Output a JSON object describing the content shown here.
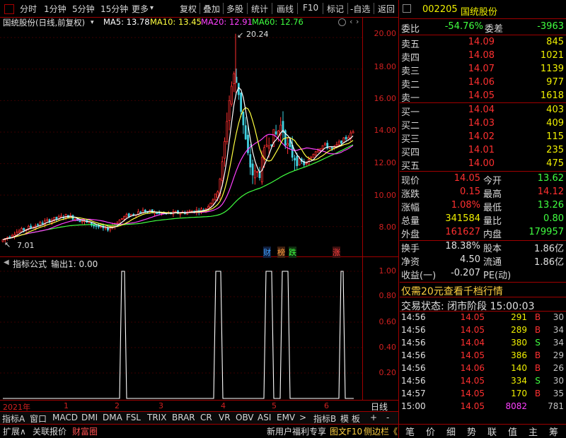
{
  "toolbar": {
    "items": [
      "分时",
      "1分钟",
      "5分钟",
      "15分钟",
      "更多",
      "复权",
      "叠加",
      "多股",
      "统计",
      "画线",
      "F10",
      "标记",
      "-自选",
      "返回"
    ],
    "more_arrow": "▾"
  },
  "chart": {
    "stock_title": "国统股份(日线,前复权)",
    "ma5": "MA5: 13.78",
    "ma10": "MA10: 13.45",
    "ma20": "MA20: 12.91",
    "ma60": "MA60: 12.76",
    "y_axis": [
      "20.00",
      "18.00",
      "16.00",
      "14.00",
      "12.00",
      "10.00",
      "8.00"
    ],
    "max_label": "20.24",
    "min_label": "7.01",
    "markers": [
      "财",
      "榜",
      "跌",
      "涨"
    ],
    "colors": {
      "up": "#ff3030",
      "down": "#40d0e0",
      "ma5": "#ffffff",
      "ma10": "#ffff40",
      "ma20": "#ff40ff",
      "ma60": "#40ff40",
      "axis": "#d02020"
    }
  },
  "indicator": {
    "title": "指标公式",
    "output": "输出1: 0.00",
    "y_axis": [
      "1.00",
      "0.80",
      "0.60",
      "0.40",
      "0.20"
    ]
  },
  "time_axis": {
    "year": "2021年",
    "months": [
      "1",
      "2",
      "3",
      "4",
      "5",
      "6"
    ],
    "period": "日线"
  },
  "tabs": [
    "指标A",
    "窗口",
    "MACD",
    "DMI",
    "DMA",
    "FSL",
    "TRIX",
    "BRAR",
    "CR",
    "VR",
    "OBV",
    "ASI",
    "EMV",
    "指标B",
    "模",
    "板"
  ],
  "tab_arrow": ">",
  "tab_controls": [
    "+",
    "-"
  ],
  "bottom_bar": {
    "left": [
      "扩展∧",
      "关联报价",
      "财富圈"
    ],
    "right": [
      "新用户福利专享",
      "图文F10",
      "侧边栏《"
    ]
  },
  "quote": {
    "code": "002205",
    "name": "国统股份",
    "weibi_label": "委比",
    "weibi": "-54.76%",
    "weicha_label": "委差",
    "weicha": "-3963",
    "sells": [
      {
        "label": "卖五",
        "price": "14.09",
        "vol": "845"
      },
      {
        "label": "卖四",
        "price": "14.08",
        "vol": "1021"
      },
      {
        "label": "卖三",
        "price": "14.07",
        "vol": "1139"
      },
      {
        "label": "卖二",
        "price": "14.06",
        "vol": "977"
      },
      {
        "label": "卖一",
        "price": "14.05",
        "vol": "1618"
      }
    ],
    "buys": [
      {
        "label": "买一",
        "price": "14.04",
        "vol": "403"
      },
      {
        "label": "买二",
        "price": "14.03",
        "vol": "409"
      },
      {
        "label": "买三",
        "price": "14.02",
        "vol": "115"
      },
      {
        "label": "买四",
        "price": "14.01",
        "vol": "235"
      },
      {
        "label": "买五",
        "price": "14.00",
        "vol": "475"
      }
    ],
    "stats": [
      {
        "l1": "现价",
        "v1": "14.05",
        "c1": "#ff3030",
        "l2": "今开",
        "v2": "13.62",
        "c2": "#40ff40"
      },
      {
        "l1": "涨跌",
        "v1": "0.15",
        "c1": "#ff3030",
        "l2": "最高",
        "v2": "14.12",
        "c2": "#ff3030"
      },
      {
        "l1": "涨幅",
        "v1": "1.08%",
        "c1": "#ff3030",
        "l2": "最低",
        "v2": "13.26",
        "c2": "#40ff40"
      },
      {
        "l1": "总量",
        "v1": "341584",
        "c1": "#f0f000",
        "l2": "量比",
        "v2": "0.80",
        "c2": "#40ff40"
      },
      {
        "l1": "外盘",
        "v1": "161627",
        "c1": "#ff3030",
        "l2": "内盘",
        "v2": "179957",
        "c2": "#40ff40"
      }
    ],
    "stats2": [
      {
        "l1": "换手",
        "v1": "18.38%",
        "c1": "#e0e0e0",
        "l2": "股本",
        "v2": "1.86亿",
        "c2": "#e0e0e0"
      },
      {
        "l1": "净资",
        "v1": "4.50",
        "c1": "#e0e0e0",
        "l2": "流通",
        "v2": "1.86亿",
        "c2": "#e0e0e0"
      },
      {
        "l1": "收益(一)",
        "v1": "-0.207",
        "c1": "#e0e0e0",
        "l2": "PE(动)",
        "v2": "",
        "c2": "#e0e0e0"
      }
    ],
    "promo": "仅需20元查看千档行情",
    "trade_status": "交易状态: 闭市阶段 15:00:03",
    "ticks": [
      {
        "time": "14:56",
        "price": "14.05",
        "pc": "#ff3030",
        "vol": "291",
        "vc": "#f0f000",
        "side": "B",
        "sc": "#ff3030",
        "cnt": "30"
      },
      {
        "time": "14:56",
        "price": "14.05",
        "pc": "#ff3030",
        "vol": "289",
        "vc": "#f0f000",
        "side": "B",
        "sc": "#ff3030",
        "cnt": "34"
      },
      {
        "time": "14:56",
        "price": "14.04",
        "pc": "#ff3030",
        "vol": "380",
        "vc": "#f0f000",
        "side": "S",
        "sc": "#40ff40",
        "cnt": "34"
      },
      {
        "time": "14:56",
        "price": "14.05",
        "pc": "#ff3030",
        "vol": "386",
        "vc": "#f0f000",
        "side": "B",
        "sc": "#ff3030",
        "cnt": "29"
      },
      {
        "time": "14:56",
        "price": "14.06",
        "pc": "#ff3030",
        "vol": "140",
        "vc": "#f0f000",
        "side": "B",
        "sc": "#ff3030",
        "cnt": "26"
      },
      {
        "time": "14:56",
        "price": "14.05",
        "pc": "#ff3030",
        "vol": "334",
        "vc": "#f0f000",
        "side": "S",
        "sc": "#40ff40",
        "cnt": "30"
      },
      {
        "time": "14:57",
        "price": "14.05",
        "pc": "#ff3030",
        "vol": "170",
        "vc": "#f0f000",
        "side": "B",
        "sc": "#ff3030",
        "cnt": "35"
      },
      {
        "time": "15:00",
        "price": "14.05",
        "pc": "#ff3030",
        "vol": "8082",
        "vc": "#ff40ff",
        "side": "",
        "sc": "#ff3030",
        "cnt": "781"
      }
    ],
    "right_tabs": [
      "笔",
      "价",
      "细",
      "势",
      "联",
      "值",
      "主",
      "筹"
    ]
  }
}
